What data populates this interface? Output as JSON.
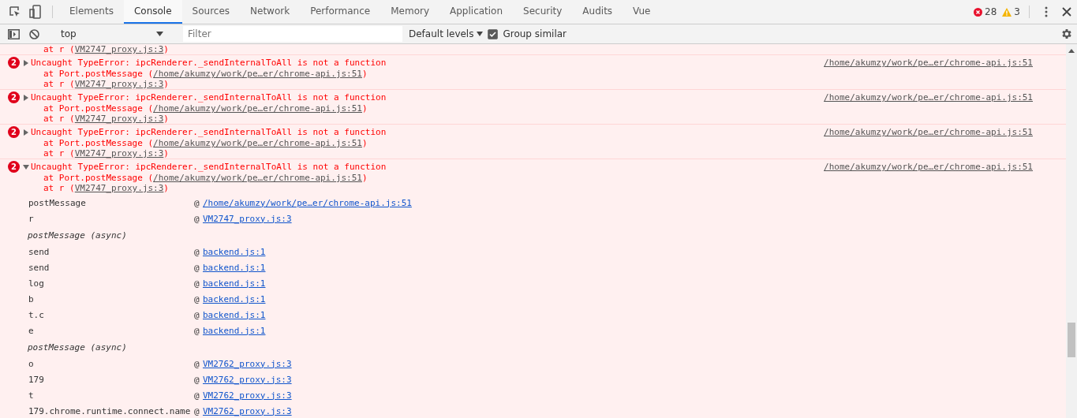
{
  "tabs": [
    {
      "label": "Elements",
      "selected": false
    },
    {
      "label": "Console",
      "selected": true
    },
    {
      "label": "Sources",
      "selected": false
    },
    {
      "label": "Network",
      "selected": false
    },
    {
      "label": "Performance",
      "selected": false
    },
    {
      "label": "Memory",
      "selected": false
    },
    {
      "label": "Application",
      "selected": false
    },
    {
      "label": "Security",
      "selected": false
    },
    {
      "label": "Audits",
      "selected": false
    },
    {
      "label": "Vue",
      "selected": false
    }
  ],
  "counters": {
    "errors": "28",
    "warnings": "3"
  },
  "toolbar": {
    "context": "top",
    "filter_placeholder": "Filter",
    "levels": "Default levels",
    "group_similar": {
      "label": "Group similar",
      "checked": true
    }
  },
  "console": {
    "leading_line": {
      "prefix": "at r (",
      "link": "VM2747_proxy.js:3",
      "suffix": ")"
    },
    "messages": [
      {
        "count": "2",
        "expanded": false,
        "text": "Uncaught TypeError: ipcRenderer._sendInternalToAll is not a function",
        "source": "/home/akumzy/work/pe…er/chrome-api.js:51",
        "stack": [
          {
            "prefix": "at Port.postMessage (",
            "link": "/home/akumzy/work/pe…er/chrome-api.js:51",
            "suffix": ")"
          },
          {
            "prefix": "at r (",
            "link": "VM2747_proxy.js:3",
            "suffix": ")"
          }
        ]
      },
      {
        "count": "2",
        "expanded": false,
        "text": "Uncaught TypeError: ipcRenderer._sendInternalToAll is not a function",
        "source": "/home/akumzy/work/pe…er/chrome-api.js:51",
        "stack": [
          {
            "prefix": "at Port.postMessage (",
            "link": "/home/akumzy/work/pe…er/chrome-api.js:51",
            "suffix": ")"
          },
          {
            "prefix": "at r (",
            "link": "VM2747_proxy.js:3",
            "suffix": ")"
          }
        ]
      },
      {
        "count": "2",
        "expanded": false,
        "text": "Uncaught TypeError: ipcRenderer._sendInternalToAll is not a function",
        "source": "/home/akumzy/work/pe…er/chrome-api.js:51",
        "stack": [
          {
            "prefix": "at Port.postMessage (",
            "link": "/home/akumzy/work/pe…er/chrome-api.js:51",
            "suffix": ")"
          },
          {
            "prefix": "at r (",
            "link": "VM2747_proxy.js:3",
            "suffix": ")"
          }
        ]
      },
      {
        "count": "2",
        "expanded": true,
        "text": "Uncaught TypeError: ipcRenderer._sendInternalToAll is not a function",
        "source": "/home/akumzy/work/pe…er/chrome-api.js:51",
        "stack": [
          {
            "prefix": "at Port.postMessage (",
            "link": "/home/akumzy/work/pe…er/chrome-api.js:51",
            "suffix": ")"
          },
          {
            "prefix": "at r (",
            "link": "VM2747_proxy.js:3",
            "suffix": ")"
          }
        ],
        "trace": [
          {
            "kind": "frame",
            "function": "postMessage",
            "at": "@",
            "location": "/home/akumzy/work/pe…er/chrome-api.js:51"
          },
          {
            "kind": "frame",
            "function": "r",
            "at": "@",
            "location": "VM2747_proxy.js:3"
          },
          {
            "kind": "async",
            "label": "postMessage (async)"
          },
          {
            "kind": "frame",
            "function": "send",
            "at": "@",
            "location": "backend.js:1"
          },
          {
            "kind": "frame",
            "function": "send",
            "at": "@",
            "location": "backend.js:1"
          },
          {
            "kind": "frame",
            "function": "log",
            "at": "@",
            "location": "backend.js:1"
          },
          {
            "kind": "frame",
            "function": "b",
            "at": "@",
            "location": "backend.js:1"
          },
          {
            "kind": "frame",
            "function": "t.c",
            "at": "@",
            "location": "backend.js:1"
          },
          {
            "kind": "frame",
            "function": "e",
            "at": "@",
            "location": "backend.js:1"
          },
          {
            "kind": "async",
            "label": "postMessage (async)"
          },
          {
            "kind": "frame",
            "function": "o",
            "at": "@",
            "location": "VM2762_proxy.js:3"
          },
          {
            "kind": "frame",
            "function": "179",
            "at": "@",
            "location": "VM2762_proxy.js:3"
          },
          {
            "kind": "frame",
            "function": "t",
            "at": "@",
            "location": "VM2762_proxy.js:3"
          },
          {
            "kind": "frame",
            "function": "179.chrome.runtime.connect.name",
            "at": "@",
            "location": "VM2762_proxy.js:3"
          }
        ]
      }
    ]
  }
}
